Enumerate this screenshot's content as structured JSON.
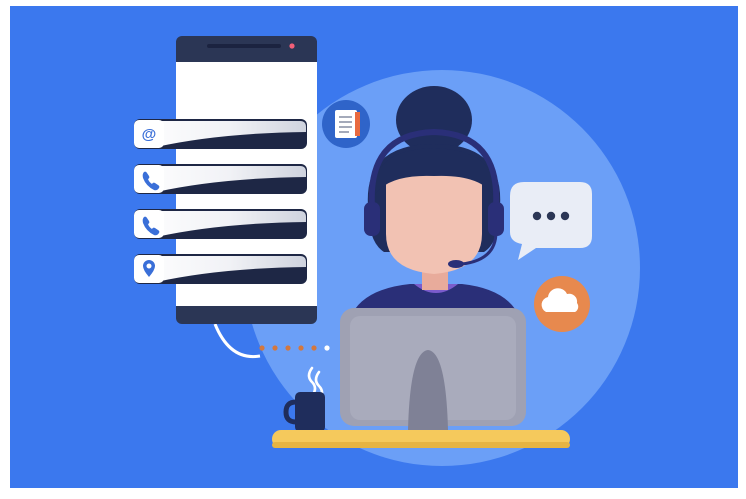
{
  "illustration": {
    "colors": {
      "background": "#3b78ee",
      "halo": "#6b9ff7",
      "phone_frame": "#2b3655",
      "phone_screen": "#ffffff",
      "field_shadow": "#1e2745",
      "field_fill": "#ffffff",
      "field_gradient_end": "#d6d9e3",
      "icon_blue": "#3a6fd8",
      "hair": "#1f2d5c",
      "skin": "#f2c2b3",
      "headset": "#2a2f78",
      "shirt": "#5b3aa0",
      "monitor": "#9fa1b3",
      "monitor_stand": "#7f8196",
      "desk": "#f5c95c",
      "mug": "#1f2d5c",
      "chat_bubble": "#e9edf6",
      "cloud_badge": "#e7894e",
      "notebook_badge": "#2f64c9",
      "connector_dots": "#d3773f"
    },
    "contact_fields": [
      {
        "icon": "at-icon",
        "glyph": "@"
      },
      {
        "icon": "phone-icon",
        "glyph": ""
      },
      {
        "icon": "phone-icon",
        "glyph": ""
      },
      {
        "icon": "location-pin-icon",
        "glyph": ""
      }
    ]
  }
}
